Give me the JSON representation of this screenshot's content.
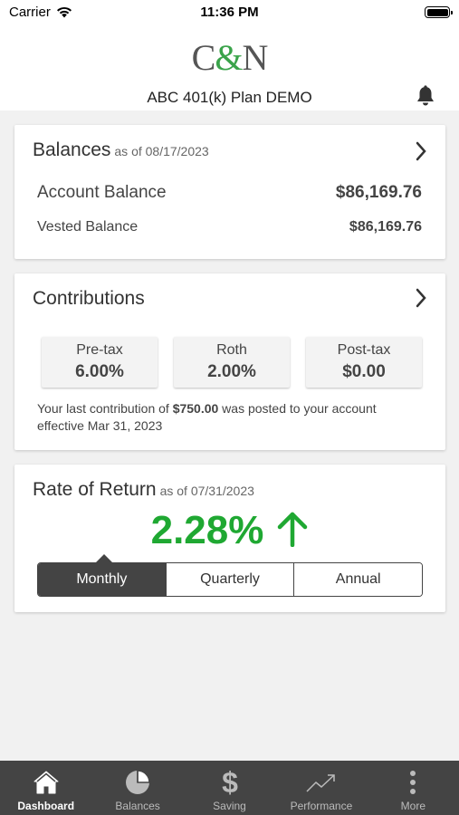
{
  "status_bar": {
    "carrier": "Carrier",
    "time": "11:36 PM"
  },
  "header": {
    "logo": {
      "left": "C",
      "amp": "&",
      "right": "N"
    },
    "plan_title": "ABC 401(k) Plan DEMO"
  },
  "balances": {
    "title": "Balances",
    "as_of": "as of 08/17/2023",
    "account_label": "Account Balance",
    "account_value": "$86,169.76",
    "vested_label": "Vested Balance",
    "vested_value": "$86,169.76"
  },
  "contributions": {
    "title": "Contributions",
    "items": [
      {
        "label": "Pre-tax",
        "value": "6.00%"
      },
      {
        "label": "Roth",
        "value": "2.00%"
      },
      {
        "label": "Post-tax",
        "value": "$0.00"
      }
    ],
    "note_prefix": "Your last contribution of ",
    "note_amount": "$750.00",
    "note_suffix": " was posted to your account effective Mar 31, 2023"
  },
  "rate_of_return": {
    "title": "Rate of Return",
    "as_of": "as of 07/31/2023",
    "value": "2.28%",
    "periods": [
      "Monthly",
      "Quarterly",
      "Annual"
    ],
    "selected": "Monthly"
  },
  "tabbar": {
    "tabs": [
      {
        "label": "Dashboard",
        "icon": "home-icon",
        "active": true
      },
      {
        "label": "Balances",
        "icon": "pie-chart-icon",
        "active": false
      },
      {
        "label": "Saving",
        "icon": "dollar-icon",
        "active": false
      },
      {
        "label": "Performance",
        "icon": "trend-icon",
        "active": false
      },
      {
        "label": "More",
        "icon": "more-dots-icon",
        "active": false
      }
    ]
  },
  "colors": {
    "accent_green": "#1fa832",
    "logo_green": "#3aa34a",
    "tabbar_bg": "#444444"
  }
}
